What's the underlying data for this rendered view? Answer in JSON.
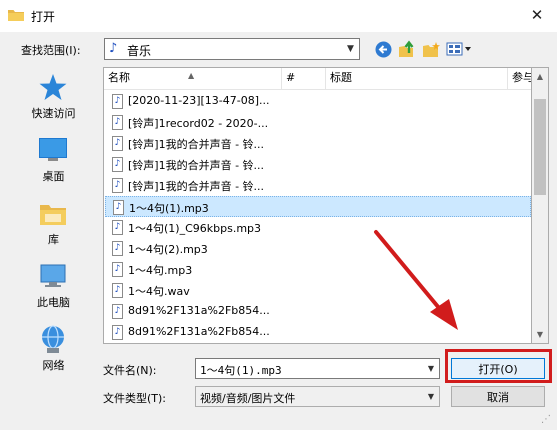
{
  "window": {
    "title": "打开",
    "close_glyph": "✕"
  },
  "look_in": {
    "label": "查找范围(I):",
    "value": "音乐",
    "folder_icon": "music-note-icon"
  },
  "toolbar": {
    "back_icon": "back-arrow-icon",
    "up_icon": "up-folder-icon",
    "new_folder_icon": "new-folder-icon",
    "view_icon": "view-menu-icon"
  },
  "places": [
    {
      "label": "快速访问",
      "icon": "quick-access-star-icon"
    },
    {
      "label": "桌面",
      "icon": "desktop-icon"
    },
    {
      "label": "库",
      "icon": "library-icon"
    },
    {
      "label": "此电脑",
      "icon": "this-pc-icon"
    },
    {
      "label": "网络",
      "icon": "network-icon"
    }
  ],
  "columns": [
    "名称",
    "#",
    "标题",
    "参与"
  ],
  "files": [
    {
      "name": "[2020-11-23][13-47-08]...",
      "selected": false
    },
    {
      "name": "[铃声]1record02 - 2020-...",
      "selected": false
    },
    {
      "name": "[铃声]1我的合并声音 - 铃...",
      "selected": false
    },
    {
      "name": "[铃声]1我的合并声音 - 铃...",
      "selected": false
    },
    {
      "name": "[铃声]1我的合并声音 - 铃...",
      "selected": false
    },
    {
      "name": "1～4句(1).mp3",
      "selected": true
    },
    {
      "name": "1～4句(1)_C96kbps.mp3",
      "selected": false
    },
    {
      "name": "1～4句(2).mp3",
      "selected": false
    },
    {
      "name": "1～4句.mp3",
      "selected": false
    },
    {
      "name": "1～4句.wav",
      "selected": false
    },
    {
      "name": "8d91%2F131a%2Fb854...",
      "selected": false
    },
    {
      "name": "8d91%2F131a%2Fb854...",
      "selected": false
    }
  ],
  "file_name": {
    "label": "文件名(N):",
    "value": "1～4句(1).mp3"
  },
  "file_type": {
    "label": "文件类型(T):",
    "value": "视频/音频/图片文件"
  },
  "buttons": {
    "open": "打开(O)",
    "cancel": "取消"
  },
  "colors": {
    "highlight_red": "#d11c1c",
    "selection_blue": "#cce8ff"
  }
}
